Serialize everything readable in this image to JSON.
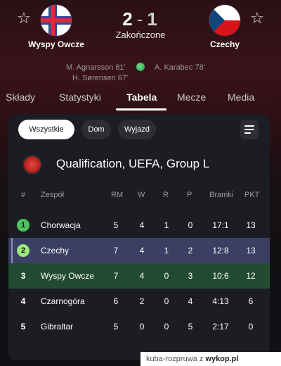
{
  "match": {
    "home_team": "Wyspy Owcze",
    "away_team": "Czechy",
    "home_score": "2",
    "separator": "-",
    "away_score": "1",
    "status": "Zakończone",
    "home_scorers": [
      "M. Agnarsson 81'",
      "H. Sørensen 67'"
    ],
    "away_scorers": [
      "A. Karabec 78'"
    ],
    "favorite_icon": "star-outline-icon",
    "goal_icon": "football-icon"
  },
  "tabs": [
    {
      "label": "Składy",
      "active": false
    },
    {
      "label": "Statystyki",
      "active": false
    },
    {
      "label": "Tabela",
      "active": true
    },
    {
      "label": "Mecze",
      "active": false
    },
    {
      "label": "Media",
      "active": false
    }
  ],
  "filters": {
    "chips": [
      "Wszystkie",
      "Dom",
      "Wyjazd"
    ],
    "selected": "Wszystkie",
    "menu_icon": "filter-list-icon"
  },
  "competition": {
    "title": "Qualification, UEFA, Group L",
    "logo_icon": "uefa-logo-icon"
  },
  "standings": {
    "columns": [
      "#",
      "Zespół",
      "RM",
      "W",
      "R",
      "P",
      "Bramki",
      "PKT"
    ],
    "rows": [
      {
        "pos": "1",
        "team": "Chorwacja",
        "rm": "5",
        "w": "4",
        "r": "1",
        "p": "0",
        "goals": "17:1",
        "pts": "13"
      },
      {
        "pos": "2",
        "team": "Czechy",
        "rm": "7",
        "w": "4",
        "r": "1",
        "p": "2",
        "goals": "12:8",
        "pts": "13"
      },
      {
        "pos": "3",
        "team": "Wyspy Owcze",
        "rm": "7",
        "w": "4",
        "r": "0",
        "p": "3",
        "goals": "10:6",
        "pts": "12"
      },
      {
        "pos": "4",
        "team": "Czarnogóra",
        "rm": "6",
        "w": "2",
        "r": "0",
        "p": "4",
        "goals": "4:13",
        "pts": "6"
      },
      {
        "pos": "5",
        "team": "Gibraltar",
        "rm": "5",
        "w": "0",
        "r": "0",
        "p": "5",
        "goals": "2:17",
        "pts": "0"
      }
    ]
  },
  "colors": {
    "qualify_badge": "#4cc35f",
    "playoff_badge": "#9be77a",
    "highlight_away": "#3a3f63",
    "highlight_home": "#234b31"
  },
  "watermark": {
    "user": "kuba-rozpruwa",
    "prefix": "z",
    "site": "wykop.pl"
  }
}
